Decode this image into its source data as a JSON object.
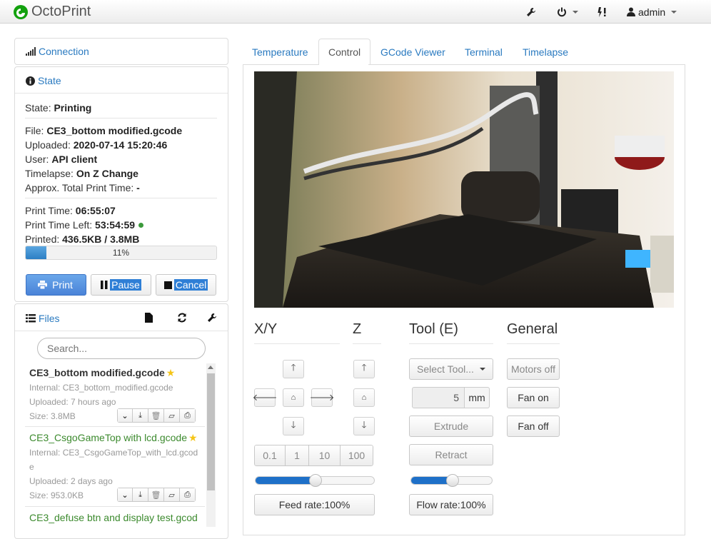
{
  "navbar": {
    "brand": "OctoPrint",
    "user": "admin"
  },
  "sidebar": {
    "connection": {
      "title": "Connection"
    },
    "state": {
      "title": "State",
      "rows": [
        {
          "label": "State: ",
          "value": "Printing"
        },
        {
          "label": "File: ",
          "value": "CE3_bottom modified.gcode"
        },
        {
          "label": "Uploaded: ",
          "value": "2020-07-14 15:20:46"
        },
        {
          "label": "User: ",
          "value": "API client"
        },
        {
          "label": "Timelapse: ",
          "value": "On Z Change"
        },
        {
          "label": "Approx. Total Print Time: ",
          "value": "-"
        },
        {
          "label": "Print Time: ",
          "value": "06:55:07"
        },
        {
          "label": "Print Time Left: ",
          "value": "53:54:59"
        },
        {
          "label": "Printed: ",
          "value": "436.5KB / 3.8MB"
        }
      ],
      "progress_percent": 11,
      "progress_label": "11%",
      "buttons": {
        "print": "Print",
        "pause": "Pause",
        "cancel": "Cancel"
      }
    },
    "files": {
      "title": "Files",
      "search_placeholder": "Search...",
      "items": [
        {
          "name": "CE3_bottom modified.gcode",
          "internal": "Internal: CE3_bottom_modified.gcode",
          "uploaded": "Uploaded: 7 hours ago",
          "size": "Size: 3.8MB",
          "color": "#222222"
        },
        {
          "name": "CE3_CsgoGameTop with lcd.gcode",
          "internal": "Internal: CE3_CsgoGameTop_with_lcd.gcod",
          "internal2": "e",
          "uploaded": "Uploaded: 2 days ago",
          "size": "Size: 953.0KB",
          "color": "#3c8a2e"
        },
        {
          "name": "CE3_defuse btn and display test.gcod",
          "color": "#3c8a2e"
        }
      ]
    }
  },
  "tabs": [
    {
      "label": "Temperature"
    },
    {
      "label": "Control"
    },
    {
      "label": "GCode Viewer"
    },
    {
      "label": "Terminal"
    },
    {
      "label": "Timelapse"
    }
  ],
  "control": {
    "xy": {
      "title": "X/Y",
      "steps": [
        "0.1",
        "1",
        "10",
        "100"
      ],
      "feed_rate": "Feed rate:100%",
      "feed_value": 100
    },
    "z": {
      "title": "Z"
    },
    "tool": {
      "title": "Tool (E)",
      "select": "Select Tool...",
      "amount": "5",
      "unit": "mm",
      "extrude": "Extrude",
      "retract": "Retract",
      "flow_rate": "Flow rate:100%",
      "flow_value": 100
    },
    "general": {
      "title": "General",
      "motors_off": "Motors off",
      "fan_on": "Fan on",
      "fan_off": "Fan off"
    }
  }
}
